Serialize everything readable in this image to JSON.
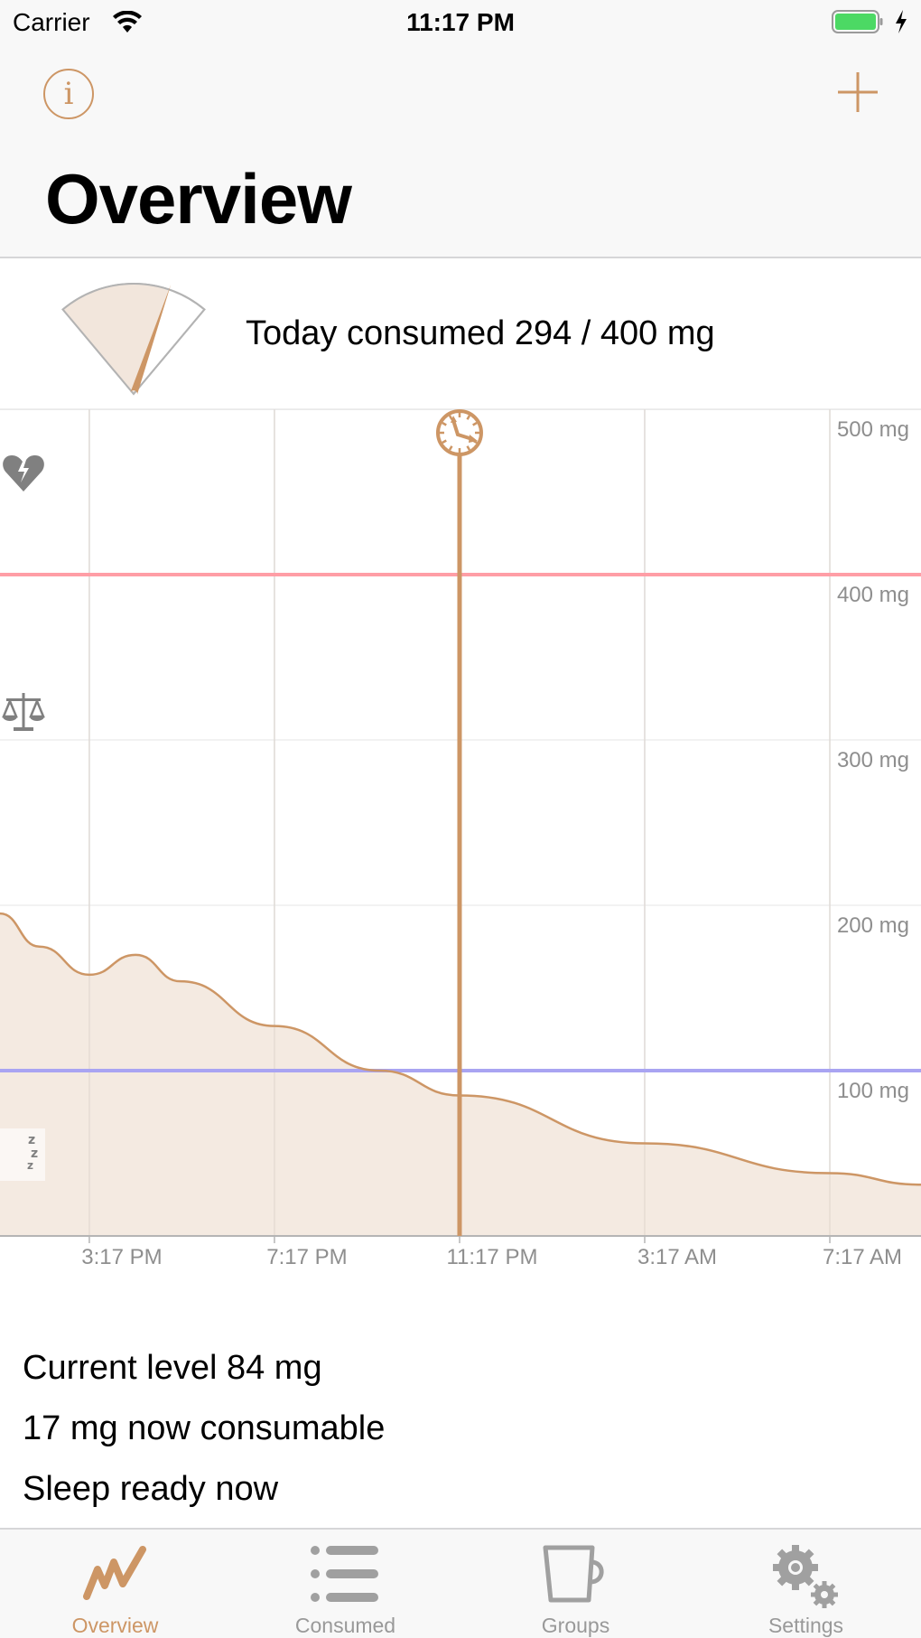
{
  "status_bar": {
    "carrier": "Carrier",
    "time": "11:17 PM",
    "battery_color": "#4cd964"
  },
  "nav": {
    "info_icon": "info-circle-icon",
    "add_icon": "plus-icon",
    "title": "Overview",
    "accent_color": "#cd9665"
  },
  "gauge": {
    "consumed_mg": 294,
    "limit_mg": 400,
    "fraction": 0.735,
    "text": "Today consumed 294 / 400 mg"
  },
  "chart_data": {
    "type": "area",
    "title": "",
    "xlabel": "",
    "ylabel": "",
    "unit": "mg",
    "x_tick_labels": [
      "3:17 PM",
      "7:17 PM",
      "11:17 PM",
      "3:17 AM",
      "7:17 AM"
    ],
    "x_hours": [
      13.35,
      14.2,
      15.28,
      16.28,
      17.25,
      19.28,
      21.55,
      23.28,
      27.28,
      31.28,
      33.25
    ],
    "values": [
      195,
      175,
      158,
      170,
      154,
      127,
      100,
      85,
      56,
      38,
      31
    ],
    "xlim_hours": [
      13.35,
      33.25
    ],
    "x_ticks_hours": [
      15.28,
      19.28,
      23.28,
      27.28,
      31.28
    ],
    "ylim": [
      0,
      500
    ],
    "y_ticks": [
      100,
      200,
      300,
      400,
      500
    ],
    "y_tick_labels": [
      "100 mg",
      "200 mg",
      "300 mg",
      "400 mg",
      "500 mg"
    ],
    "grid": true,
    "now_hour": 23.28,
    "now_icon": "clock-icon",
    "thresholds": [
      {
        "name": "daily-limit",
        "value": 400,
        "color": "#ff9ea6",
        "icon": "broken-heart-icon"
      },
      {
        "name": "sleep-level",
        "value": 100,
        "color": "#a9a4f2",
        "icon": "sleep-moon-icon"
      }
    ],
    "side_icons": [
      "broken-heart-icon",
      "balance-scale-icon",
      "sleep-moon-icon"
    ],
    "line_color": "#cd9665",
    "fill_color": "#f2e6dc"
  },
  "summary": {
    "current_level": "Current level 84 mg",
    "consumable": "17 mg now consumable",
    "sleep": "Sleep ready now"
  },
  "tabs": [
    {
      "label": "Overview",
      "icon": "trend-chart-icon",
      "active": true
    },
    {
      "label": "Consumed",
      "icon": "list-icon",
      "active": false
    },
    {
      "label": "Groups",
      "icon": "cup-icon",
      "active": false
    },
    {
      "label": "Settings",
      "icon": "gears-icon",
      "active": false
    }
  ]
}
